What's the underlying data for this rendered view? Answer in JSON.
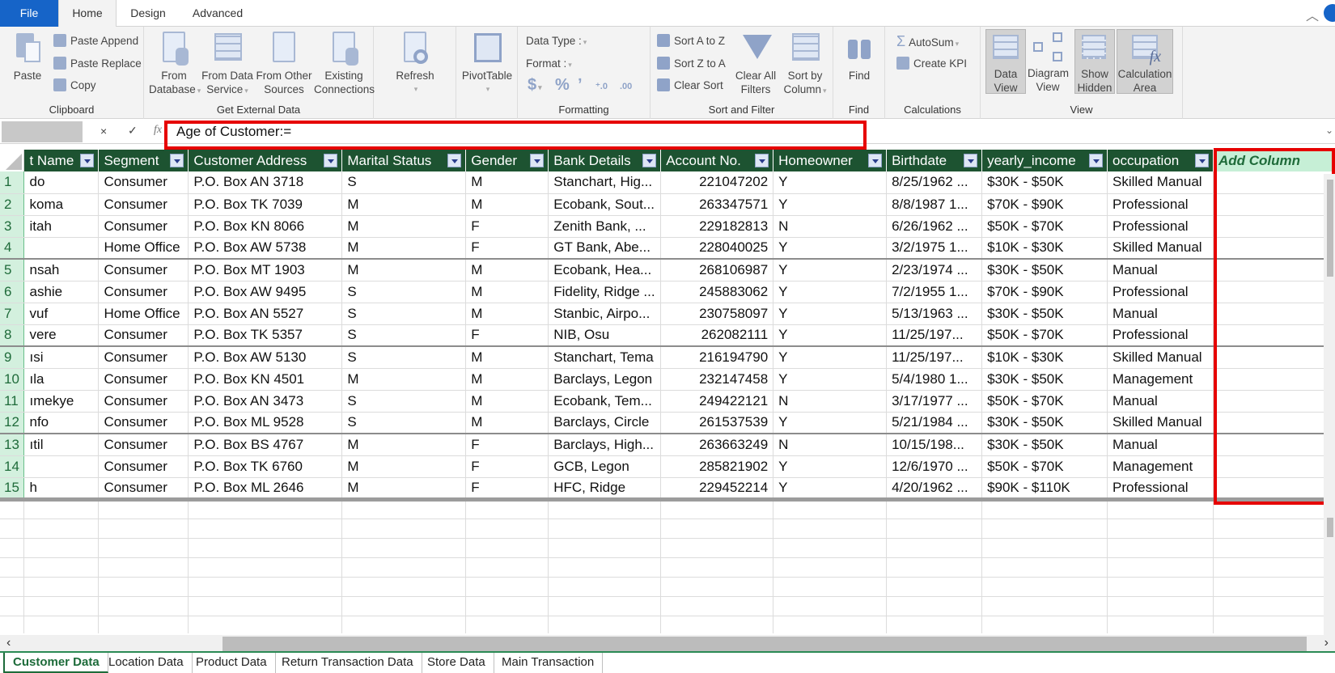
{
  "menu_tabs": {
    "file": "File",
    "home": "Home",
    "design": "Design",
    "advanced": "Advanced"
  },
  "ribbon": {
    "clipboard": {
      "label": "Clipboard",
      "paste": "Paste",
      "paste_append": "Paste Append",
      "paste_replace": "Paste Replace",
      "copy": "Copy"
    },
    "external": {
      "label": "Get External Data",
      "from_database_1": "From",
      "from_database_2": "Database",
      "from_service_1": "From Data",
      "from_service_2": "Service",
      "from_other_1": "From Other",
      "from_other_2": "Sources",
      "existing_1": "Existing",
      "existing_2": "Connections"
    },
    "refresh": "Refresh",
    "pivot": "PivotTable",
    "formatting": {
      "label": "Formatting",
      "data_type": "Data Type :",
      "format": "Format :",
      "currency": "$",
      "percent": "%",
      "comma": "ʼ",
      "inc_dec": ".0→.00",
      "dec_dec": ".00→.0"
    },
    "sort": {
      "label": "Sort and Filter",
      "a_to_z": "Sort A to Z",
      "z_to_a": "Sort Z to A",
      "clear_sort": "Clear Sort",
      "clear_filters_1": "Clear All",
      "clear_filters_2": "Filters",
      "sort_col_1": "Sort by",
      "sort_col_2": "Column"
    },
    "find": {
      "label": "Find",
      "btn": "Find"
    },
    "calculations": {
      "label": "Calculations",
      "autosum": "AutoSum",
      "kpi": "Create KPI"
    },
    "view": {
      "label": "View",
      "data_1": "Data",
      "data_2": "View",
      "diagram_1": "Diagram",
      "diagram_2": "View",
      "hidden_1": "Show",
      "hidden_2": "Hidden",
      "calc_1": "Calculation",
      "calc_2": "Area"
    }
  },
  "formula_bar": {
    "cancel": "×",
    "enter": "✓",
    "fx": "fx",
    "value": "Age of Customer:="
  },
  "table": {
    "columns": [
      "t Name",
      "Segment",
      "Customer Address",
      "Marital Status",
      "Gender",
      "Bank Details",
      "Account No.",
      "Homeowner",
      "Birthdate",
      "yearly_income",
      "occupation"
    ],
    "add_column": "Add Column",
    "rows": [
      [
        "1",
        "do",
        "Consumer",
        "P.O. Box AN 3718",
        "S",
        "M",
        "Stanchart, Hig...",
        "221047202",
        "Y",
        "8/25/1962 ...",
        "$30K - $50K",
        "Skilled Manual"
      ],
      [
        "2",
        "koma",
        "Consumer",
        "P.O. Box TK 7039",
        "M",
        "M",
        "Ecobank, Sout...",
        "263347571",
        "Y",
        "8/8/1987 1...",
        "$70K - $90K",
        "Professional"
      ],
      [
        "3",
        "itah",
        "Consumer",
        "P.O. Box KN 8066",
        "M",
        "F",
        "Zenith Bank, ...",
        "229182813",
        "N",
        "6/26/1962 ...",
        "$50K - $70K",
        "Professional"
      ],
      [
        "4",
        "",
        "Home Office",
        "P.O. Box AW 5738",
        "M",
        "F",
        "GT Bank, Abe...",
        "228040025",
        "Y",
        "3/2/1975 1...",
        "$10K - $30K",
        "Skilled Manual"
      ],
      [
        "5",
        "nsah",
        "Consumer",
        "P.O. Box MT 1903",
        "M",
        "M",
        "Ecobank, Hea...",
        "268106987",
        "Y",
        "2/23/1974 ...",
        "$30K - $50K",
        "Manual"
      ],
      [
        "6",
        "ashie",
        "Consumer",
        "P.O. Box AW 9495",
        "S",
        "M",
        "Fidelity, Ridge ...",
        "245883062",
        "Y",
        "7/2/1955 1...",
        "$70K - $90K",
        "Professional"
      ],
      [
        "7",
        "vuf",
        "Home Office",
        "P.O. Box AN 5527",
        "S",
        "M",
        "Stanbic, Airpo...",
        "230758097",
        "Y",
        "5/13/1963 ...",
        "$30K - $50K",
        "Manual"
      ],
      [
        "8",
        "vere",
        "Consumer",
        "P.O. Box TK 5357",
        "S",
        "F",
        "NIB, Osu",
        "262082111",
        "Y",
        "11/25/197...",
        "$50K - $70K",
        "Professional"
      ],
      [
        "9",
        "ısi",
        "Consumer",
        "P.O. Box AW 5130",
        "S",
        "M",
        "Stanchart, Tema",
        "216194790",
        "Y",
        "11/25/197...",
        "$10K - $30K",
        "Skilled Manual"
      ],
      [
        "10",
        "ıla",
        "Consumer",
        "P.O. Box KN 4501",
        "M",
        "M",
        "Barclays, Legon",
        "232147458",
        "Y",
        "5/4/1980 1...",
        "$30K - $50K",
        "Management"
      ],
      [
        "11",
        "ımekye",
        "Consumer",
        "P.O. Box AN 3473",
        "S",
        "M",
        "Ecobank, Tem...",
        "249422121",
        "N",
        "3/17/1977 ...",
        "$50K - $70K",
        "Manual"
      ],
      [
        "12",
        "nfo",
        "Consumer",
        "P.O. Box ML 9528",
        "S",
        "M",
        "Barclays, Circle",
        "261537539",
        "Y",
        "5/21/1984 ...",
        "$30K - $50K",
        "Skilled Manual"
      ],
      [
        "13",
        "ıtil",
        "Consumer",
        "P.O. Box BS 4767",
        "M",
        "F",
        "Barclays, High...",
        "263663249",
        "N",
        "10/15/198...",
        "$30K - $50K",
        "Manual"
      ],
      [
        "14",
        "",
        "Consumer",
        "P.O. Box TK 6760",
        "M",
        "F",
        "GCB, Legon",
        "285821902",
        "Y",
        "12/6/1970 ...",
        "$50K - $70K",
        "Management"
      ],
      [
        "15",
        "h",
        "Consumer",
        "P.O. Box ML 2646",
        "M",
        "F",
        "HFC, Ridge",
        "229452214",
        "Y",
        "4/20/1962 ...",
        "$90K - $110K",
        "Professional"
      ]
    ]
  },
  "sheet_tabs": [
    "Customer Data",
    "Location Data",
    "Product Data",
    "Return Transaction Data",
    "Store Data",
    "Main Transaction"
  ],
  "colors": {
    "header_bg": "#1d5331",
    "accent_blue": "#1664c8",
    "highlight_red": "#e60000",
    "add_column_bg": "#c6efd6"
  }
}
